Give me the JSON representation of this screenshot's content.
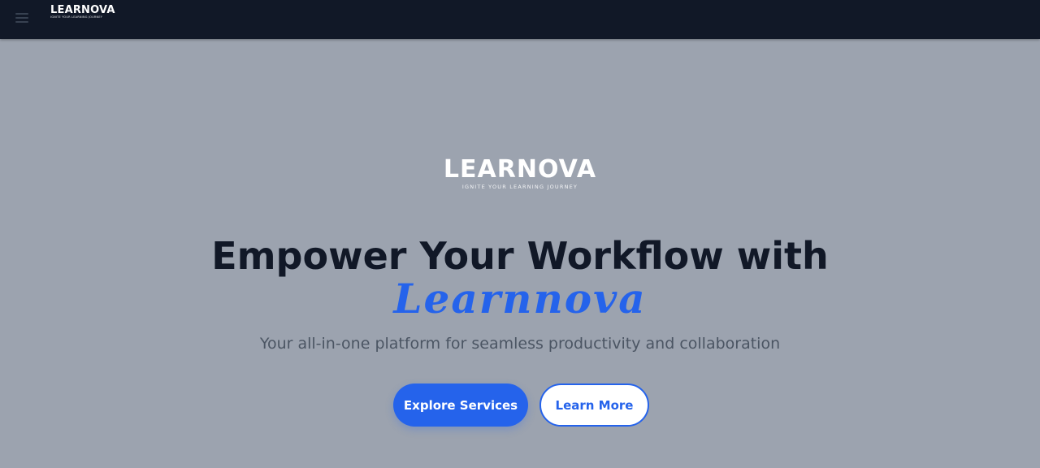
{
  "colors": {
    "nav_bg": "#111827",
    "page_bg": "#9ca3af",
    "accent": "#2563eb",
    "headline": "#111827",
    "subtitle": "#4b5563"
  },
  "nav": {
    "menu_icon": "hamburger-icon",
    "brand_name": "LEARNOVA",
    "brand_tagline": "IGNITE YOUR LEARNING JOURNEY"
  },
  "hero": {
    "logo_name": "LEARNOVA",
    "logo_tagline": "IGNITE YOUR LEARNING JOURNEY",
    "headline": "Empower Your Workflow with",
    "accent": "Learnnova",
    "subtitle": "Your all-in-one platform for seamless productivity and collaboration",
    "primary_button": "Explore Services",
    "secondary_button": "Learn More"
  }
}
